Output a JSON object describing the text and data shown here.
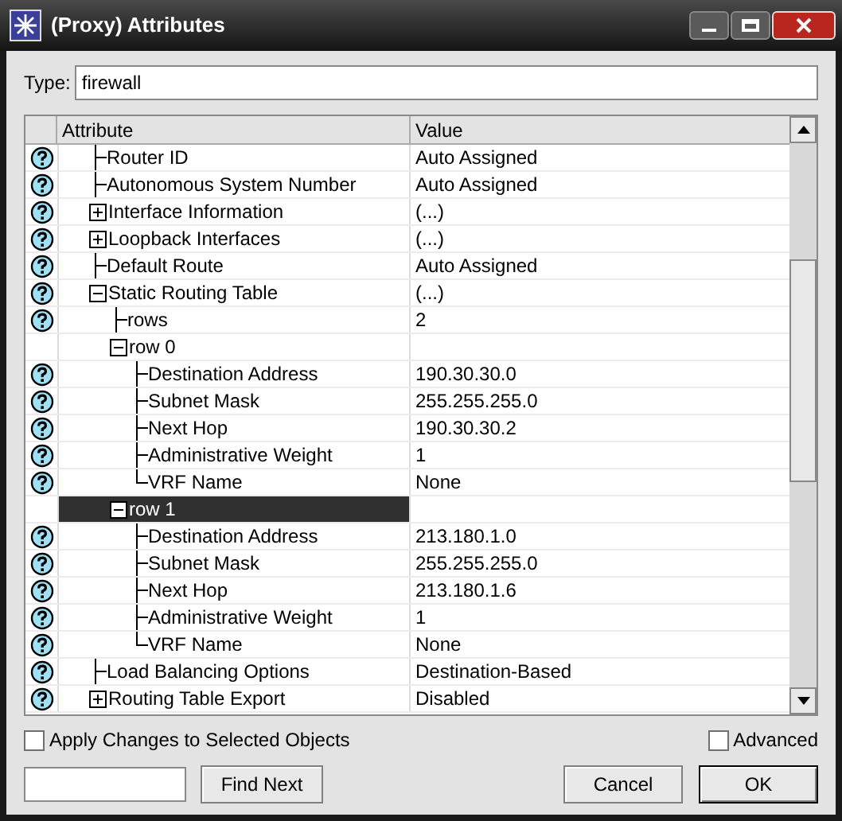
{
  "window": {
    "title": "(Proxy) Attributes"
  },
  "type_field": {
    "label": "Type:",
    "value": "firewall"
  },
  "table": {
    "columns": [
      "Attribute",
      "Value"
    ],
    "rows": [
      {
        "label": "Router ID",
        "value": "Auto Assigned",
        "help": true,
        "kind": "leaf",
        "selected": false
      },
      {
        "label": "Autonomous System Number",
        "value": "Auto Assigned",
        "help": true,
        "kind": "leaf",
        "selected": false
      },
      {
        "label": "Interface Information",
        "value": "(...)",
        "help": true,
        "kind": "group",
        "expanded": false,
        "selected": false
      },
      {
        "label": "Loopback Interfaces",
        "value": "(...)",
        "help": true,
        "kind": "group",
        "expanded": false,
        "selected": false
      },
      {
        "label": "Default Route",
        "value": "Auto Assigned",
        "help": true,
        "kind": "leaf",
        "selected": false
      },
      {
        "label": "Static Routing Table",
        "value": "(...)",
        "help": true,
        "kind": "group",
        "expanded": true,
        "selected": false,
        "children": [
          {
            "label": "rows",
            "value": "2",
            "help": true,
            "kind": "leaf",
            "selected": false
          },
          {
            "label": "row 0",
            "help": false,
            "kind": "group",
            "expanded": true,
            "selected": false,
            "children": [
              {
                "label": "Destination Address",
                "value": "190.30.30.0",
                "help": true,
                "kind": "leaf",
                "selected": false
              },
              {
                "label": "Subnet Mask",
                "value": "255.255.255.0",
                "help": true,
                "kind": "leaf",
                "selected": false
              },
              {
                "label": "Next Hop",
                "value": "190.30.30.2",
                "help": true,
                "kind": "leaf",
                "selected": false
              },
              {
                "label": "Administrative Weight",
                "value": "1",
                "help": true,
                "kind": "leaf",
                "selected": false
              },
              {
                "label": "VRF Name",
                "value": "None",
                "help": true,
                "kind": "leaf",
                "selected": false
              }
            ]
          },
          {
            "label": "row 1",
            "help": false,
            "kind": "group",
            "expanded": true,
            "selected": true,
            "children": [
              {
                "label": "Destination Address",
                "value": "213.180.1.0",
                "help": true,
                "kind": "leaf",
                "selected": false
              },
              {
                "label": "Subnet Mask",
                "value": "255.255.255.0",
                "help": true,
                "kind": "leaf",
                "selected": false
              },
              {
                "label": "Next Hop",
                "value": "213.180.1.6",
                "help": true,
                "kind": "leaf",
                "selected": false
              },
              {
                "label": "Administrative Weight",
                "value": "1",
                "help": true,
                "kind": "leaf",
                "selected": false
              },
              {
                "label": "VRF Name",
                "value": "None",
                "help": true,
                "kind": "leaf",
                "selected": false
              }
            ]
          }
        ]
      },
      {
        "label": "Load Balancing Options",
        "value": "Destination-Based",
        "help": true,
        "kind": "leaf",
        "selected": false
      },
      {
        "label": "Routing Table Export",
        "value": "Disabled",
        "help": true,
        "kind": "group",
        "expanded": false,
        "selected": false
      }
    ]
  },
  "apply_checkbox": {
    "label": "Apply Changes to Selected Objects",
    "checked": false
  },
  "advanced_checkbox": {
    "label": "Advanced",
    "checked": false
  },
  "buttons": [
    {
      "label": "Find Next"
    },
    {
      "label": "Cancel"
    },
    {
      "label": "OK",
      "default": true
    }
  ]
}
